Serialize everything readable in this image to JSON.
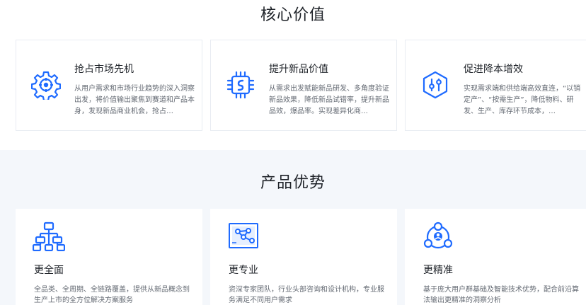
{
  "core_value": {
    "title": "核心价值",
    "cards": [
      {
        "title": "抢占市场先机",
        "desc": "从用户需求和市场行业趋势的深入洞察出发，将价值输出聚焦到赛道和产品本身，发现新品商业机会，抢占…",
        "icon": "gear-target-icon"
      },
      {
        "title": "提升新品价值",
        "desc": "从需求出发赋能新品研发、多角度验证新品效果，降低新品试错率，提升新品品效，爆品率。实现差异化商…",
        "icon": "chip-icon"
      },
      {
        "title": "促进降本增效",
        "desc": "实现需求端和供给端高效直连，“以销定产”、“按需生产”，降低物料、研发、生产、库存环节成本，…",
        "icon": "hexagon-sliders-icon"
      }
    ]
  },
  "advantages": {
    "title": "产品优势",
    "cards": [
      {
        "title": "更全面",
        "desc": "全品类、全周期、全链路覆盖，提供从新品概念到生产上市的全方位解决方案服务",
        "icon": "org-chart-icon"
      },
      {
        "title": "更专业",
        "desc": "资深专家团队，行业头部咨询和设计机构，专业服务满足不同用户需求",
        "icon": "network-board-icon"
      },
      {
        "title": "更精准",
        "desc": "基于庞大用户群基础及智能技术优势，配合前沿算法输出更精准的洞察分析",
        "icon": "user-cluster-icon"
      }
    ]
  },
  "colors": {
    "accent": "#1f6bff",
    "background_alt": "#f4f7fb"
  }
}
